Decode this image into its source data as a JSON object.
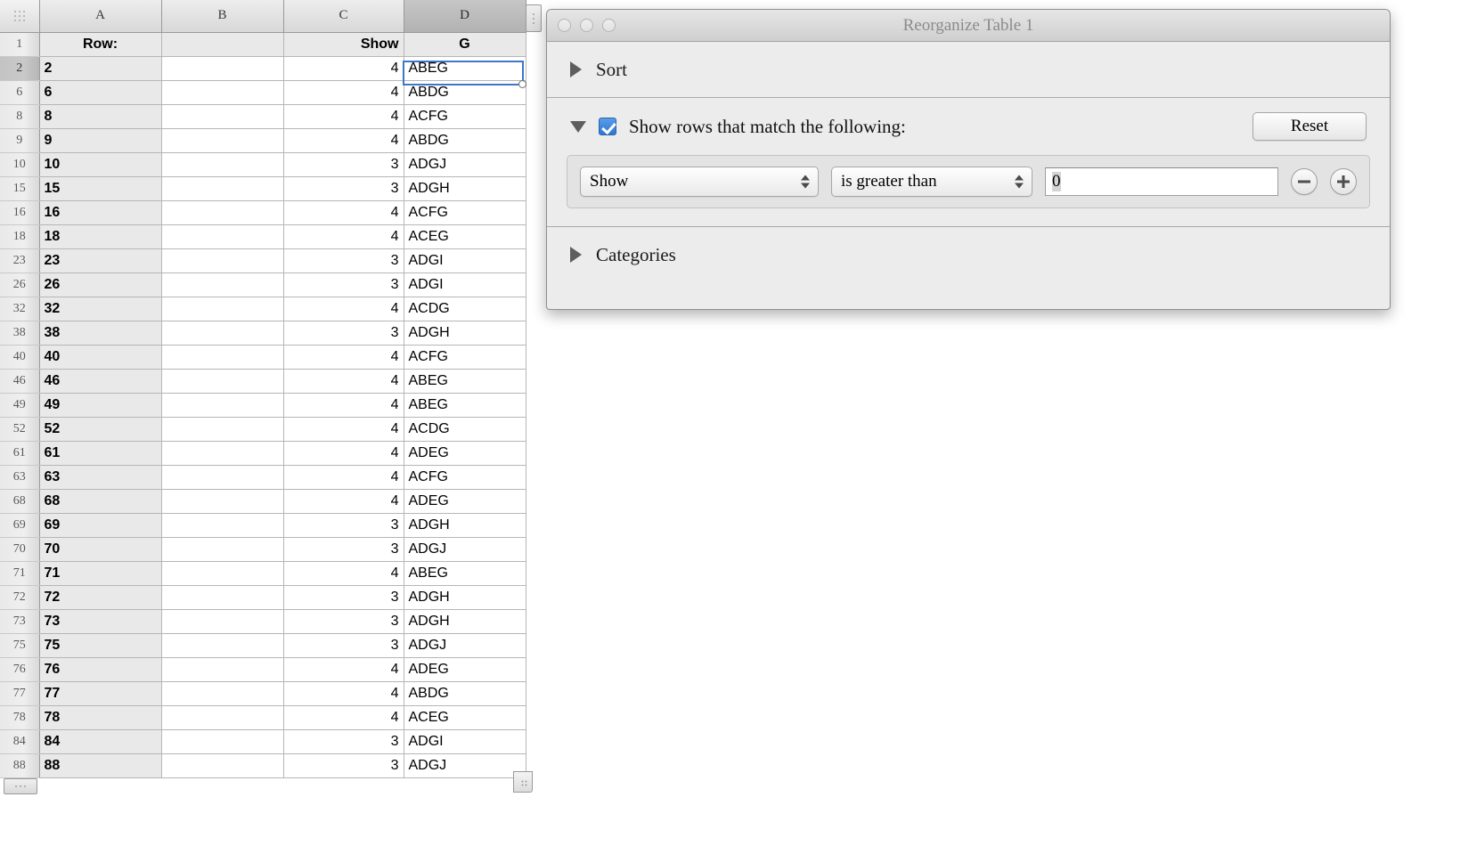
{
  "spreadsheet": {
    "columns": [
      {
        "id": "A",
        "label": "A",
        "selected": false
      },
      {
        "id": "B",
        "label": "B",
        "selected": false
      },
      {
        "id": "C",
        "label": "C",
        "selected": false
      },
      {
        "id": "D",
        "label": "D",
        "selected": true
      }
    ],
    "header_row": {
      "number": "1",
      "A": "Row:",
      "B": "",
      "C": "Show",
      "D": "G"
    },
    "selected_cell": "D2",
    "rows": [
      {
        "num": "2",
        "A": "2",
        "B": "",
        "C": "4",
        "D": "ABEG",
        "selected": true
      },
      {
        "num": "6",
        "A": "6",
        "B": "",
        "C": "4",
        "D": "ABDG",
        "selected": false
      },
      {
        "num": "8",
        "A": "8",
        "B": "",
        "C": "4",
        "D": "ACFG",
        "selected": false
      },
      {
        "num": "9",
        "A": "9",
        "B": "",
        "C": "4",
        "D": "ABDG",
        "selected": false
      },
      {
        "num": "10",
        "A": "10",
        "B": "",
        "C": "3",
        "D": "ADGJ",
        "selected": false
      },
      {
        "num": "15",
        "A": "15",
        "B": "",
        "C": "3",
        "D": "ADGH",
        "selected": false
      },
      {
        "num": "16",
        "A": "16",
        "B": "",
        "C": "4",
        "D": "ACFG",
        "selected": false
      },
      {
        "num": "18",
        "A": "18",
        "B": "",
        "C": "4",
        "D": "ACEG",
        "selected": false
      },
      {
        "num": "23",
        "A": "23",
        "B": "",
        "C": "3",
        "D": "ADGI",
        "selected": false
      },
      {
        "num": "26",
        "A": "26",
        "B": "",
        "C": "3",
        "D": "ADGI",
        "selected": false
      },
      {
        "num": "32",
        "A": "32",
        "B": "",
        "C": "4",
        "D": "ACDG",
        "selected": false
      },
      {
        "num": "38",
        "A": "38",
        "B": "",
        "C": "3",
        "D": "ADGH",
        "selected": false
      },
      {
        "num": "40",
        "A": "40",
        "B": "",
        "C": "4",
        "D": "ACFG",
        "selected": false
      },
      {
        "num": "46",
        "A": "46",
        "B": "",
        "C": "4",
        "D": "ABEG",
        "selected": false
      },
      {
        "num": "49",
        "A": "49",
        "B": "",
        "C": "4",
        "D": "ABEG",
        "selected": false
      },
      {
        "num": "52",
        "A": "52",
        "B": "",
        "C": "4",
        "D": "ACDG",
        "selected": false
      },
      {
        "num": "61",
        "A": "61",
        "B": "",
        "C": "4",
        "D": "ADEG",
        "selected": false
      },
      {
        "num": "63",
        "A": "63",
        "B": "",
        "C": "4",
        "D": "ACFG",
        "selected": false
      },
      {
        "num": "68",
        "A": "68",
        "B": "",
        "C": "4",
        "D": "ADEG",
        "selected": false
      },
      {
        "num": "69",
        "A": "69",
        "B": "",
        "C": "3",
        "D": "ADGH",
        "selected": false
      },
      {
        "num": "70",
        "A": "70",
        "B": "",
        "C": "3",
        "D": "ADGJ",
        "selected": false
      },
      {
        "num": "71",
        "A": "71",
        "B": "",
        "C": "4",
        "D": "ABEG",
        "selected": false
      },
      {
        "num": "72",
        "A": "72",
        "B": "",
        "C": "3",
        "D": "ADGH",
        "selected": false
      },
      {
        "num": "73",
        "A": "73",
        "B": "",
        "C": "3",
        "D": "ADGH",
        "selected": false
      },
      {
        "num": "75",
        "A": "75",
        "B": "",
        "C": "3",
        "D": "ADGJ",
        "selected": false
      },
      {
        "num": "76",
        "A": "76",
        "B": "",
        "C": "4",
        "D": "ADEG",
        "selected": false
      },
      {
        "num": "77",
        "A": "77",
        "B": "",
        "C": "4",
        "D": "ABDG",
        "selected": false
      },
      {
        "num": "78",
        "A": "78",
        "B": "",
        "C": "4",
        "D": "ACEG",
        "selected": false
      },
      {
        "num": "84",
        "A": "84",
        "B": "",
        "C": "3",
        "D": "ADGI",
        "selected": false
      },
      {
        "num": "88",
        "A": "88",
        "B": "",
        "C": "3",
        "D": "ADGJ",
        "selected": false
      }
    ]
  },
  "dialog": {
    "title": "Reorganize Table 1",
    "sort": {
      "label": "Sort",
      "expanded": false
    },
    "filter": {
      "label": "Show rows that match the following:",
      "expanded": true,
      "checkbox_checked": true,
      "reset_label": "Reset",
      "rule": {
        "field": "Show",
        "condition": "is greater than",
        "value": "0",
        "remove_label": "−",
        "add_label": "+"
      }
    },
    "categories": {
      "label": "Categories",
      "expanded": false
    }
  },
  "colors": {
    "accent_blue": "#3d77cc",
    "checkbox_blue": "#2f77d4",
    "dialog_bg": "#ececec",
    "header_gray": "#d8d8d8",
    "selected_col_gray": "#b2b2b2"
  }
}
